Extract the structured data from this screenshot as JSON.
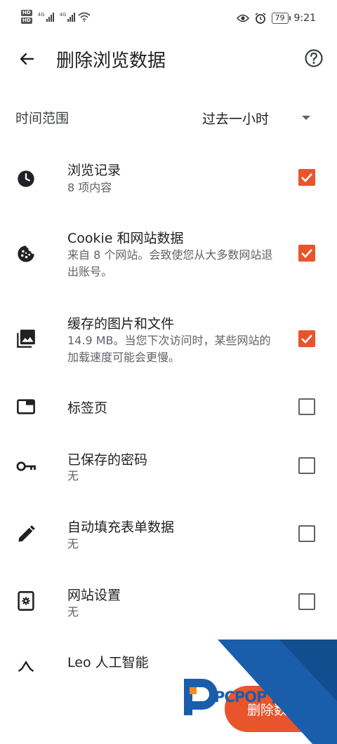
{
  "status_bar": {
    "hd1": "HD",
    "hd2": "HD",
    "net1": "4G",
    "net2": "4G",
    "battery": "79",
    "time": "9:21",
    "icons": [
      "eye-icon",
      "alarm-icon",
      "battery-icon",
      "wifi-icon"
    ]
  },
  "header": {
    "title": "删除浏览数据",
    "back_icon": "arrow-left-icon",
    "help_icon": "help-circle-icon"
  },
  "time_range": {
    "label": "时间范围",
    "value": "过去一小时"
  },
  "items": [
    {
      "title": "浏览记录",
      "subtitle": "8 项内容",
      "checked": true,
      "icon": "clock-icon"
    },
    {
      "title": "Cookie 和网站数据",
      "subtitle": "来自 8 个网站。会致使您从大多数网站退出账号。",
      "checked": true,
      "icon": "cookie-icon"
    },
    {
      "title": "缓存的图片和文件",
      "subtitle": "14.9 MB。当您下次访问时，某些网站的加载速度可能会更慢。",
      "checked": true,
      "icon": "image-icon"
    },
    {
      "title": "标签页",
      "subtitle": "",
      "checked": false,
      "icon": "tab-icon"
    },
    {
      "title": "已保存的密码",
      "subtitle": "无",
      "checked": false,
      "icon": "key-icon"
    },
    {
      "title": "自动填充表单数据",
      "subtitle": "无",
      "checked": false,
      "icon": "pencil-icon"
    },
    {
      "title": "网站设置",
      "subtitle": "无",
      "checked": false,
      "icon": "site-settings-icon"
    },
    {
      "title": "Leo 人工智能",
      "subtitle": "",
      "checked": false,
      "icon": "leo-ai-icon"
    }
  ],
  "delete_button": {
    "label": "删除数"
  },
  "watermark": {
    "text": "PCPOP下载"
  },
  "colors": {
    "accent": "#e8542c",
    "watermark_blue": "#1a5dab"
  }
}
